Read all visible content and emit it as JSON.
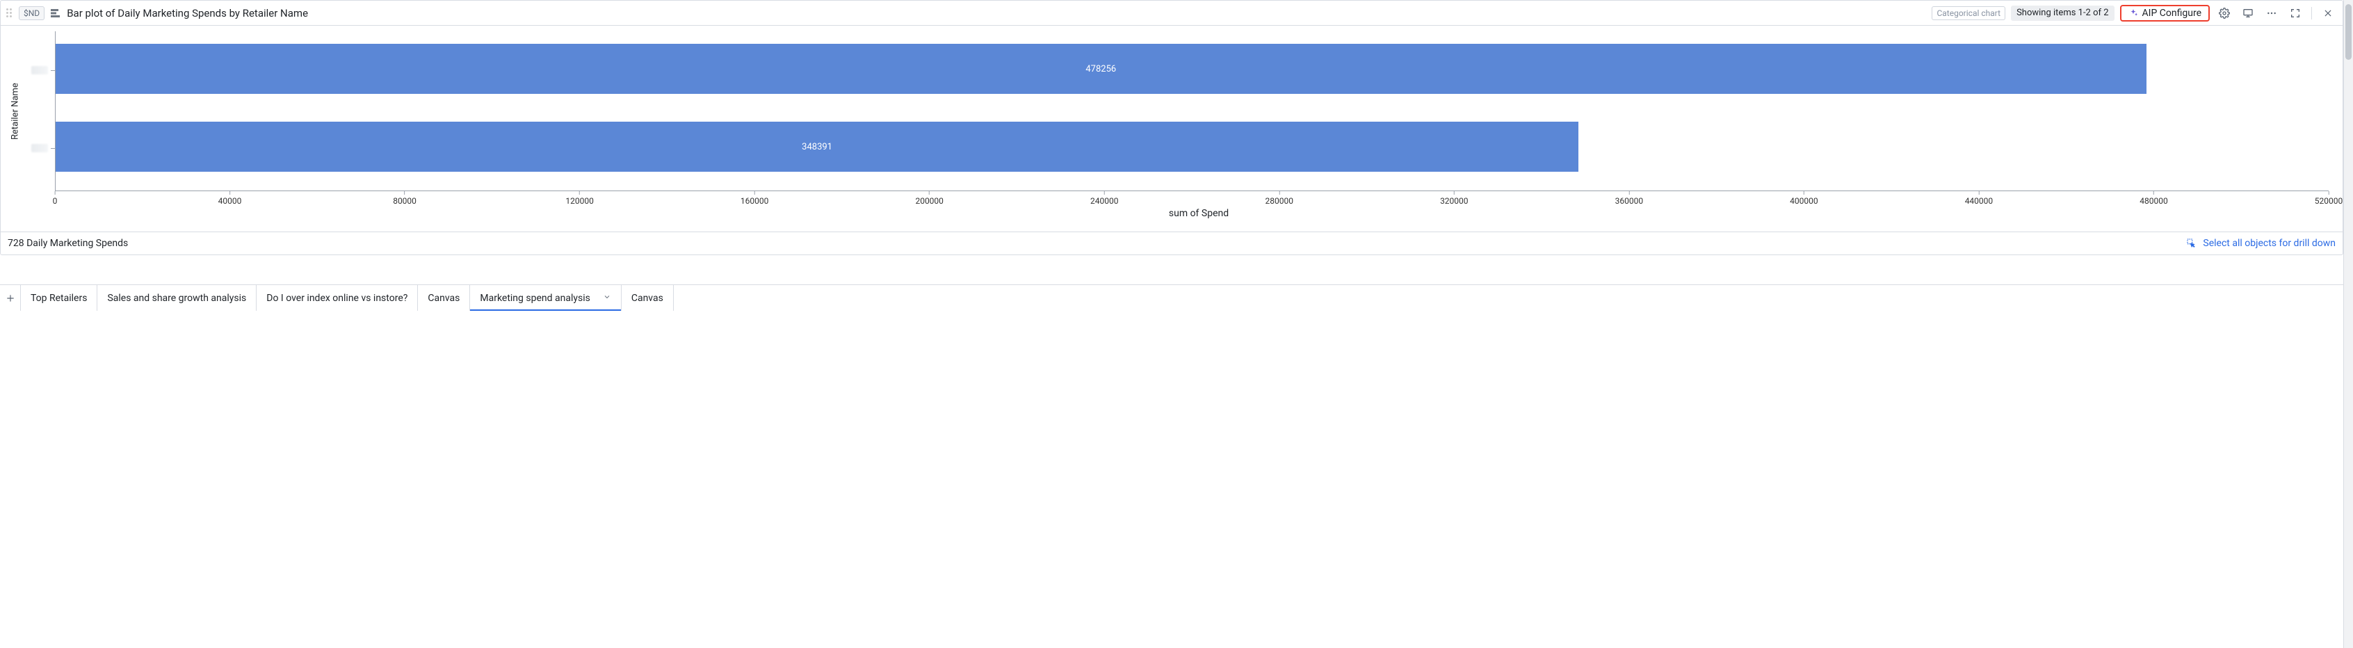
{
  "header": {
    "chip_nd": "$ND",
    "title": "Bar plot of Daily Marketing Spends by Retailer Name",
    "categorical_label": "Categorical chart",
    "showing": "Showing items 1-2 of 2",
    "aip_label": "AIP Configure"
  },
  "chart_data": {
    "type": "bar",
    "orientation": "horizontal",
    "title": "Bar plot of Daily Marketing Spends by Retailer Name",
    "ylabel": "Retailer Name",
    "xlabel": "sum of Spend",
    "xlim": [
      0,
      520000
    ],
    "x_ticks": [
      0,
      40000,
      80000,
      120000,
      160000,
      200000,
      240000,
      280000,
      320000,
      360000,
      400000,
      440000,
      480000,
      520000
    ],
    "categories": [
      "",
      ""
    ],
    "values": [
      478256,
      348391
    ],
    "value_labels": [
      "478256",
      "348391"
    ],
    "bar_color": "#5b87d6"
  },
  "footer": {
    "count_label": "728 Daily Marketing Spends",
    "drill_label": "Select all objects for drill down"
  },
  "tabs": {
    "items": [
      {
        "label": "Top Retailers"
      },
      {
        "label": "Sales and share growth analysis"
      },
      {
        "label": "Do I over index online vs instore?"
      },
      {
        "label": "Canvas"
      },
      {
        "label": "Marketing spend analysis",
        "active": true
      },
      {
        "label": "Canvas"
      }
    ]
  }
}
